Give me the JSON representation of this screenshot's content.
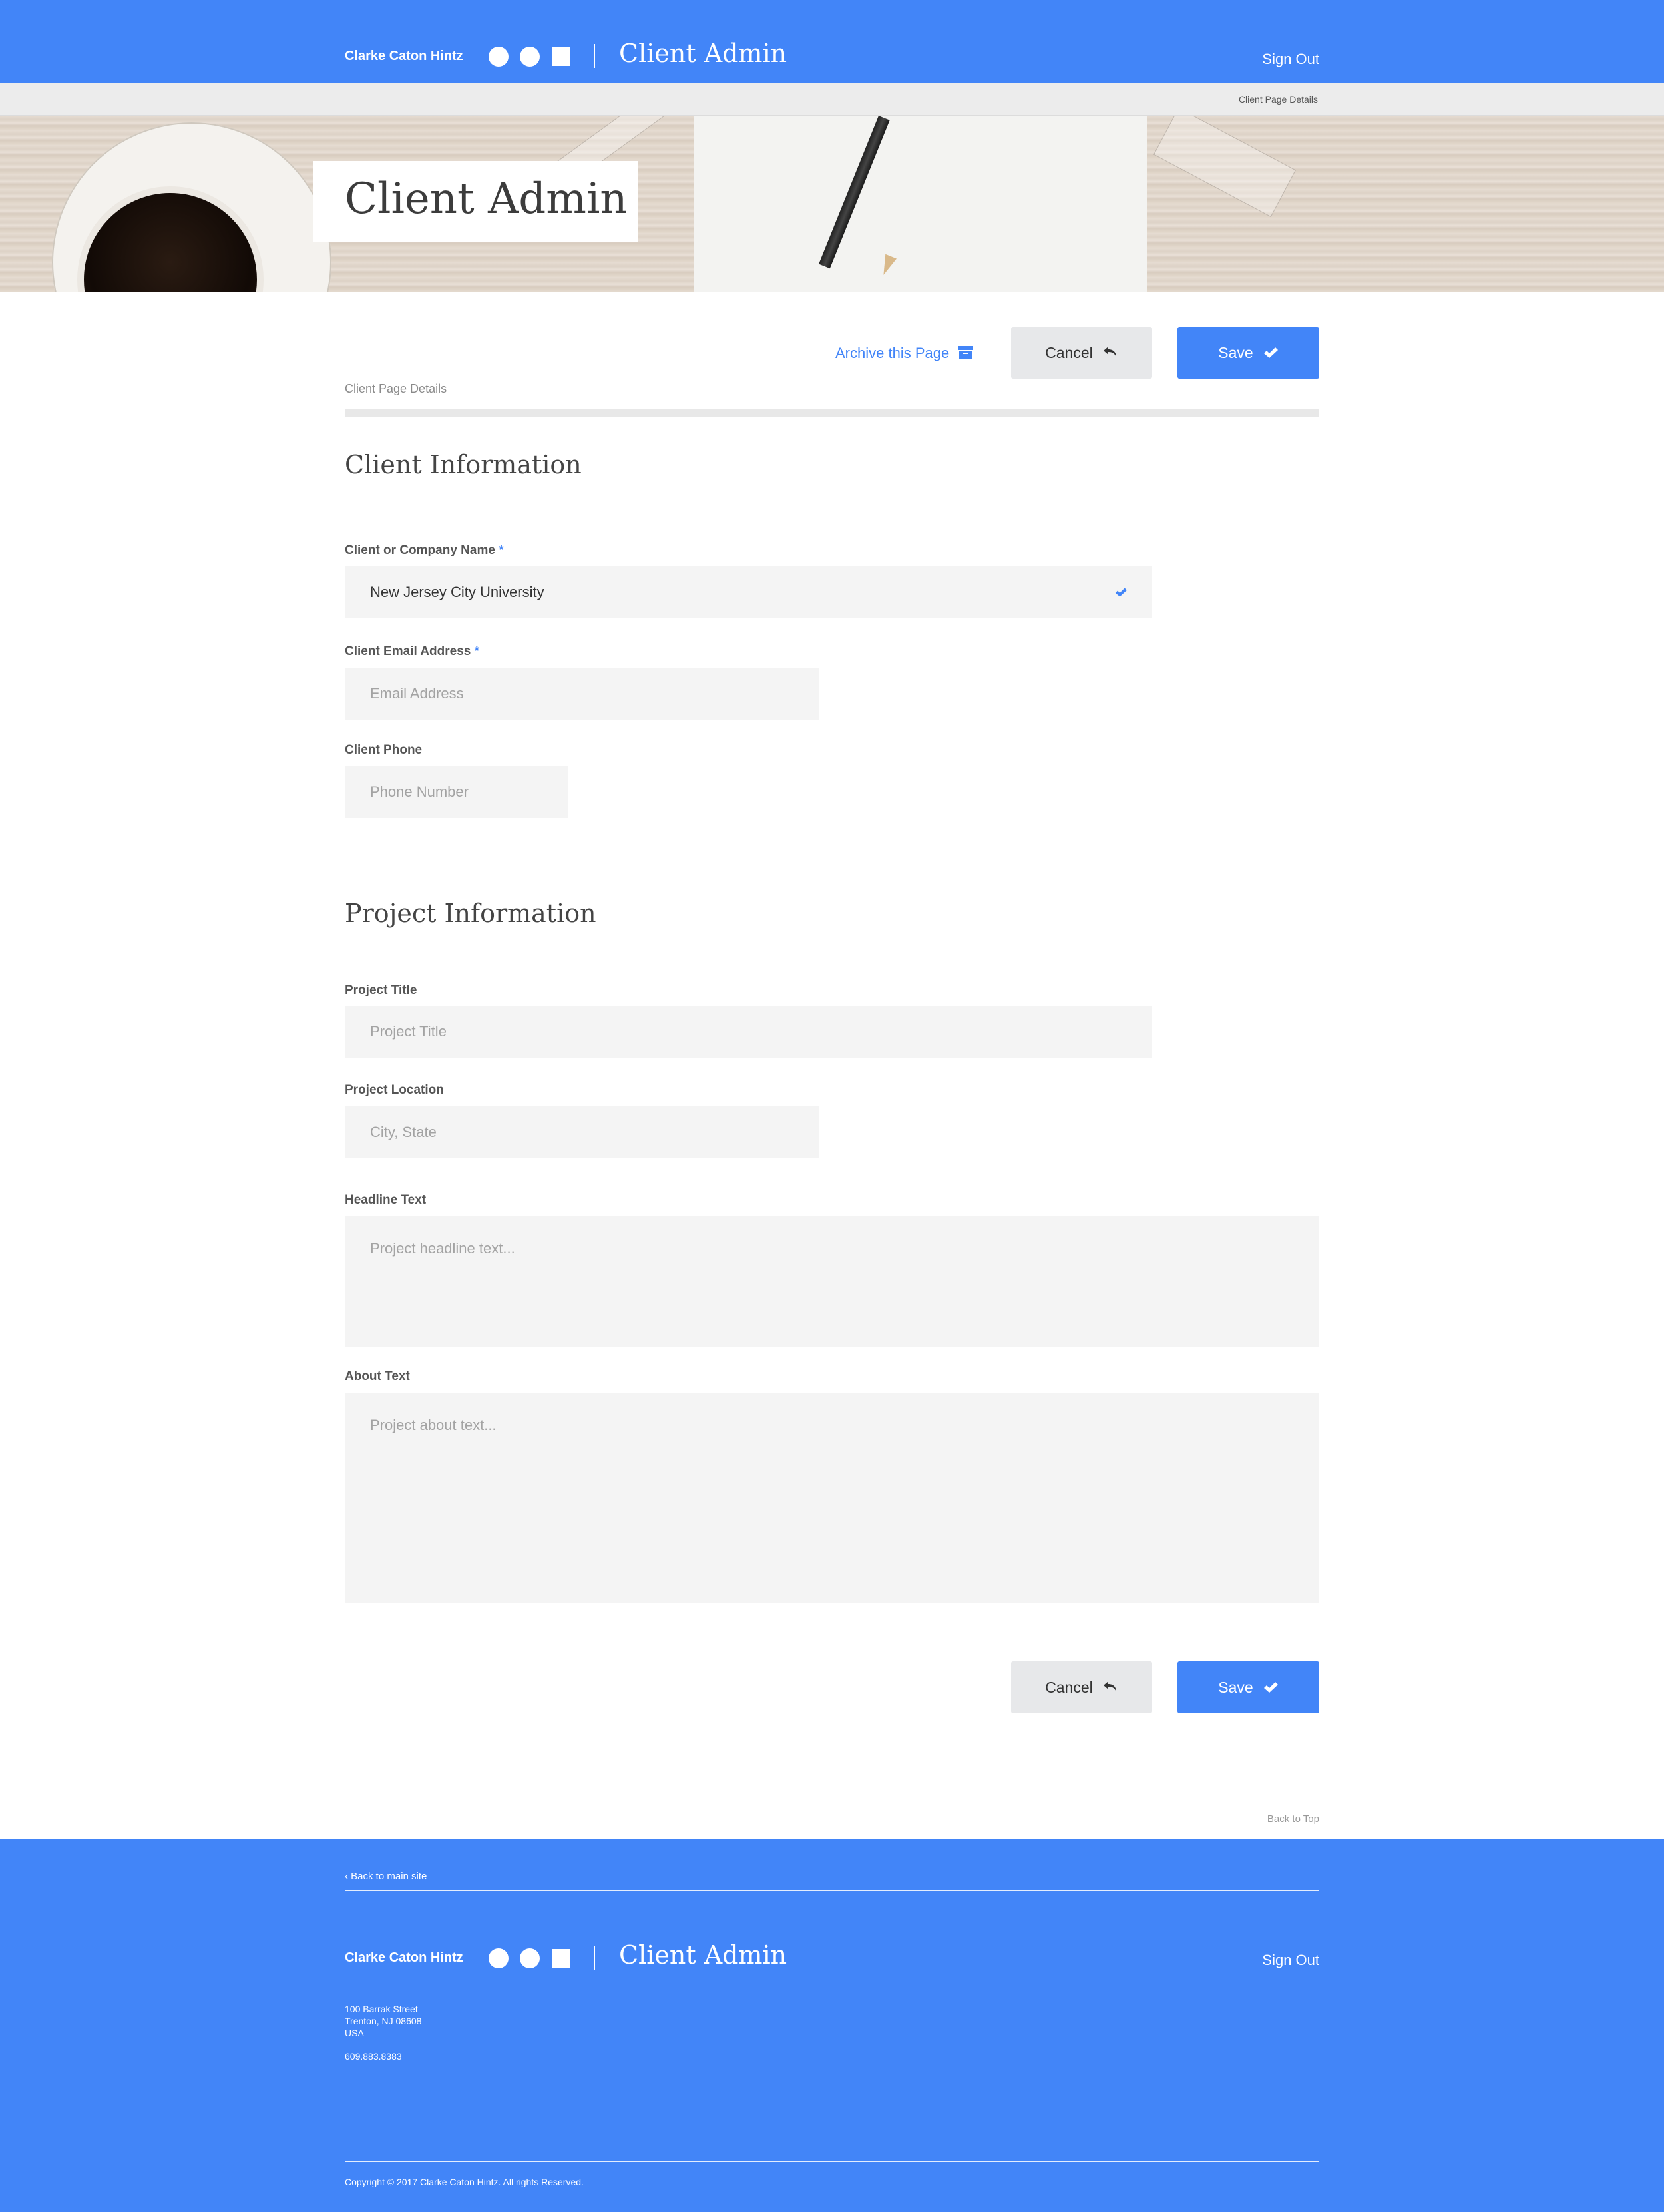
{
  "header": {
    "brand": "Clarke Caton Hintz",
    "app_title": "Client Admin",
    "sign_out": "Sign Out",
    "breadcrumb": "Client Page Details",
    "accent_color": "#4285F8"
  },
  "hero": {
    "title": "Client Admin"
  },
  "actions": {
    "archive_label": "Archive this Page",
    "cancel_label": "Cancel",
    "save_label": "Save",
    "section_label": "Client Page Details"
  },
  "client_info": {
    "heading": "Client Information",
    "company_label": "Client or Company Name",
    "company_value": "New Jersey City University",
    "email_label": "Client Email Address",
    "email_placeholder": "Email Address",
    "phone_label": "Client Phone",
    "phone_placeholder": "Phone Number",
    "required_mark": "*"
  },
  "project_info": {
    "heading": "Project Information",
    "title_label": "Project Title",
    "title_placeholder": "Project Title",
    "location_label": "Project Location",
    "location_placeholder": "City, State",
    "headline_label": "Headline Text",
    "headline_placeholder": "Project headline text...",
    "about_label": "About Text",
    "about_placeholder": "Project about text..."
  },
  "bottom_actions": {
    "cancel_label": "Cancel",
    "save_label": "Save",
    "back_to_top": "Back to Top"
  },
  "footer": {
    "back_link": "Back to main site",
    "brand": "Clarke Caton Hintz",
    "app_title": "Client Admin",
    "sign_out": "Sign Out",
    "address_line1": "100 Barrak Street",
    "address_line2": "Trenton, NJ 08608",
    "address_line3": "USA",
    "phone": "609.883.8383",
    "copyright": "Copyright © 2017 Clarke Caton Hintz. All rights Reserved."
  }
}
